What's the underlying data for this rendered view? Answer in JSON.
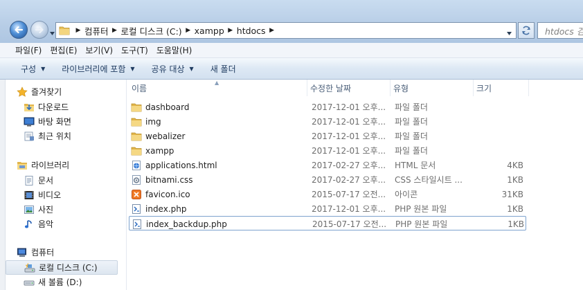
{
  "address": {
    "crumbs": [
      "컴퓨터",
      "로컬 디스크 (C:)",
      "xampp",
      "htdocs"
    ],
    "search_placeholder": "htdocs 검"
  },
  "menu": [
    "파일(F)",
    "편집(E)",
    "보기(V)",
    "도구(T)",
    "도움말(H)"
  ],
  "commands": [
    {
      "label": "구성",
      "dropdown": true
    },
    {
      "label": "라이브러리에 포함",
      "dropdown": true
    },
    {
      "label": "공유 대상",
      "dropdown": true
    },
    {
      "label": "새 폴더",
      "dropdown": false
    }
  ],
  "nav": {
    "favorites": {
      "label": "즐겨찾기",
      "icon": "star-icon",
      "items": [
        {
          "label": "다운로드",
          "icon": "downloads-icon"
        },
        {
          "label": "바탕 화면",
          "icon": "desktop-icon"
        },
        {
          "label": "최근 위치",
          "icon": "recent-places-icon"
        }
      ]
    },
    "libraries": {
      "label": "라이브러리",
      "icon": "library-icon",
      "items": [
        {
          "label": "문서",
          "icon": "documents-icon"
        },
        {
          "label": "비디오",
          "icon": "videos-icon"
        },
        {
          "label": "사진",
          "icon": "pictures-icon"
        },
        {
          "label": "음악",
          "icon": "music-icon"
        }
      ]
    },
    "computer": {
      "label": "컴퓨터",
      "icon": "computer-icon",
      "items": [
        {
          "label": "로컬 디스크 (C:)",
          "icon": "local-disk-icon",
          "selected": true
        },
        {
          "label": "새 볼륨 (D:)",
          "icon": "drive-icon"
        }
      ]
    }
  },
  "columns": {
    "name": "이름",
    "date": "수정한 날짜",
    "type": "유형",
    "size": "크기"
  },
  "files": [
    {
      "name": "dashboard",
      "date": "2017-12-01 오후...",
      "type": "파일 폴더",
      "size": "",
      "icon": "folder-icon"
    },
    {
      "name": "img",
      "date": "2017-12-01 오후...",
      "type": "파일 폴더",
      "size": "",
      "icon": "folder-icon"
    },
    {
      "name": "webalizer",
      "date": "2017-12-01 오후...",
      "type": "파일 폴더",
      "size": "",
      "icon": "folder-icon"
    },
    {
      "name": "xampp",
      "date": "2017-12-01 오후...",
      "type": "파일 폴더",
      "size": "",
      "icon": "folder-icon"
    },
    {
      "name": "applications.html",
      "date": "2017-02-27 오후...",
      "type": "HTML 문서",
      "size": "4KB",
      "icon": "html-file-icon"
    },
    {
      "name": "bitnami.css",
      "date": "2017-02-27 오후...",
      "type": "CSS 스타일시트 ...",
      "size": "1KB",
      "icon": "css-file-icon"
    },
    {
      "name": "favicon.ico",
      "date": "2015-07-17 오전...",
      "type": "아이콘",
      "size": "31KB",
      "icon": "ico-file-icon"
    },
    {
      "name": "index.php",
      "date": "2017-12-01 오후...",
      "type": "PHP 원본 파일",
      "size": "1KB",
      "icon": "php-file-icon"
    },
    {
      "name": "index_backdup.php",
      "date": "2015-07-17 오전...",
      "type": "PHP 원본 파일",
      "size": "1KB",
      "icon": "php-file-icon",
      "selected": true
    }
  ]
}
